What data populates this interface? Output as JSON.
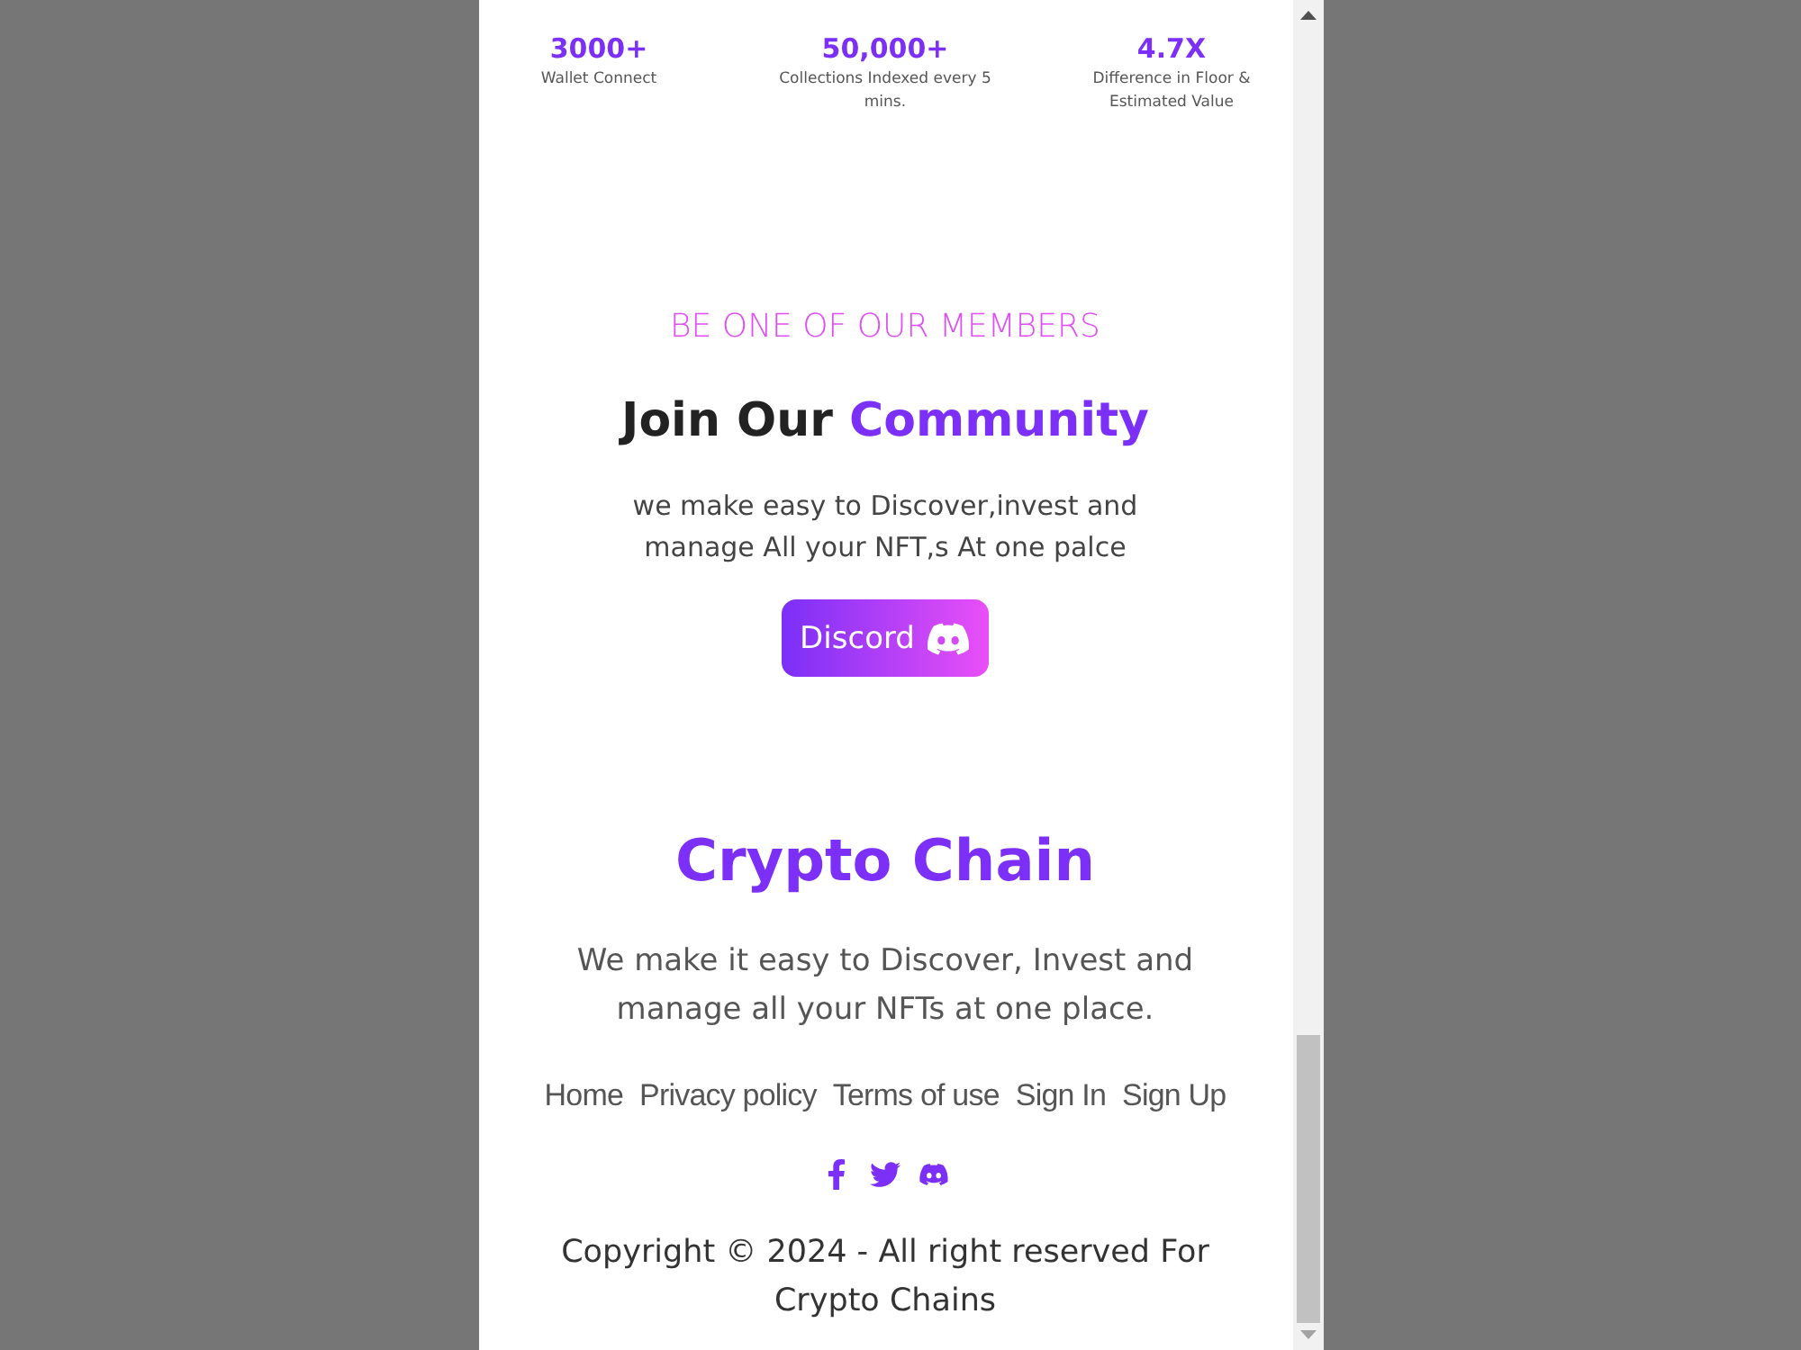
{
  "stats": [
    {
      "value": "3000+",
      "label": "Wallet Connect"
    },
    {
      "value": "50,000+",
      "label": "Collections Indexed every 5 mins."
    },
    {
      "value": "4.7X",
      "label": "Difference in Floor & Estimated Value"
    }
  ],
  "community": {
    "eyebrow": "BE ONE OF OUR MEMBERS",
    "title": [
      {
        "text": "Join Our",
        "highlight": false
      },
      {
        "text": "Community",
        "highlight": true
      }
    ],
    "description": "we make easy to Discover,invest and manage All your NFT,s At one palce",
    "button": {
      "label": "Discord"
    }
  },
  "footer": {
    "brand": "Crypto Chain",
    "tagline": "We make it easy to Discover, Invest and manage all your NFTs at one place.",
    "links": [
      "Home",
      "Privacy policy",
      "Terms of use",
      "Sign In",
      "Sign Up"
    ],
    "copyright": "Copyright © 2024 - All right reserved For Crypto Chains"
  }
}
